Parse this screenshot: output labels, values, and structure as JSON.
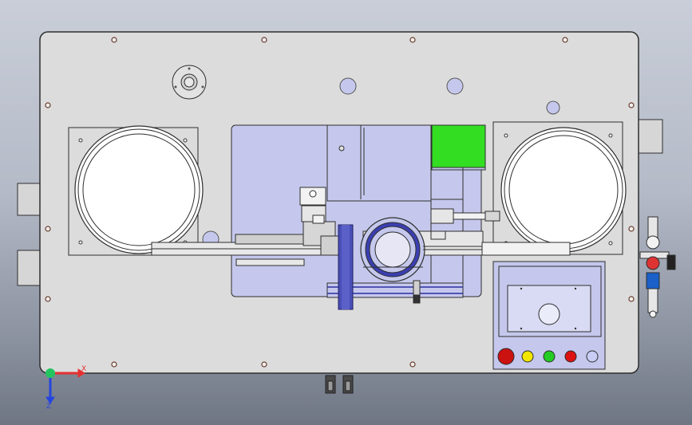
{
  "viewport": {
    "background_top": "#c9ced8",
    "background_bottom": "#6f7683"
  },
  "machine": {
    "plate_color": "#dcdcdc",
    "outline_color": "#2e2e2e",
    "fixture_color": "#c5c8ec",
    "accent_color": "#2d2fa0",
    "green_block_color": "#33dd22"
  },
  "control_panel": {
    "frame_color": "#c5c8ec",
    "screen_color": "#d9dbf4",
    "buttons": [
      {
        "name": "emergency-stop-button",
        "color": "#cc1111"
      },
      {
        "name": "yellow-button",
        "color": "#f2e600"
      },
      {
        "name": "green-button",
        "color": "#22cc22"
      },
      {
        "name": "red-button",
        "color": "#dd1111"
      },
      {
        "name": "blue-button",
        "color": "#c8cdf5"
      }
    ]
  },
  "triad": {
    "x_label": "X",
    "z_label": "Z",
    "x_color": "#e53030",
    "y_color": "#22c55e",
    "z_color": "#2545e0"
  }
}
